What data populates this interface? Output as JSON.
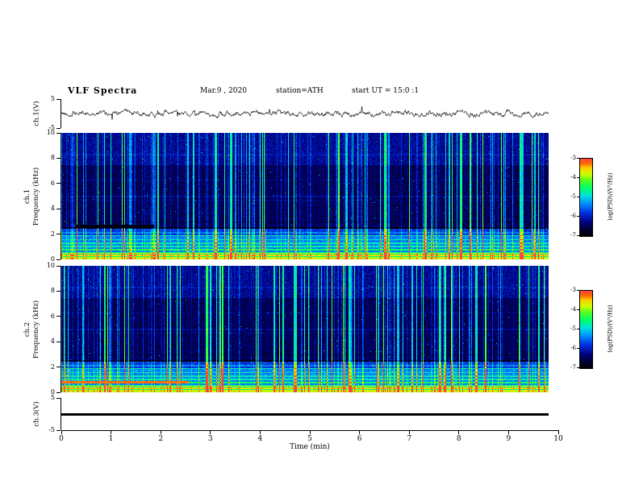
{
  "header": {
    "title": "VLF Spectra",
    "date": "Mar.9 , 2020",
    "station": "station=ATH",
    "start_ut": "start UT = 15:0 :1"
  },
  "x_axis": {
    "label": "Time (min)",
    "min": 0,
    "max": 10,
    "ticks": [
      0,
      1,
      2,
      3,
      4,
      5,
      6,
      7,
      8,
      9,
      10
    ]
  },
  "panels": {
    "ch1v": {
      "ylabel": "ch.1(V)",
      "ticks": [
        5,
        -5
      ],
      "min": -5,
      "max": 5
    },
    "spec1": {
      "ylabel_line1": "ch.1",
      "ylabel_line2": "Frequency (kHz)",
      "ticks": [
        0,
        2,
        4,
        6,
        8,
        10
      ],
      "min": 0,
      "max": 10
    },
    "spec2": {
      "ylabel_line1": "ch.2",
      "ylabel_line2": "Frequency (kHz)",
      "ticks": [
        0,
        2,
        4,
        6,
        8,
        10
      ],
      "min": 0,
      "max": 10
    },
    "ch3v": {
      "ylabel": "ch.3(V)",
      "ticks": [
        5,
        -5
      ],
      "min": -5,
      "max": 5
    }
  },
  "colorbars": [
    {
      "label": "log(PSD)/(V²/Hz)",
      "ticks": [
        -3,
        -4,
        -5,
        -6,
        -7
      ],
      "min": -7,
      "max": -3
    },
    {
      "label": "log(PSD)/(V²/Hz)",
      "ticks": [
        -3,
        -4,
        -5,
        -6,
        -7
      ],
      "min": -7,
      "max": -3
    }
  ],
  "colormap": [
    {
      "v": 0.0,
      "c": "#000000"
    },
    {
      "v": 0.08,
      "c": "#000030"
    },
    {
      "v": 0.18,
      "c": "#000080"
    },
    {
      "v": 0.3,
      "c": "#0030e0"
    },
    {
      "v": 0.42,
      "c": "#0090ff"
    },
    {
      "v": 0.52,
      "c": "#00e0e0"
    },
    {
      "v": 0.62,
      "c": "#00ff66"
    },
    {
      "v": 0.72,
      "c": "#55ff22"
    },
    {
      "v": 0.8,
      "c": "#ccff00"
    },
    {
      "v": 0.88,
      "c": "#ffcc00"
    },
    {
      "v": 0.94,
      "c": "#ff6600"
    },
    {
      "v": 1.0,
      "c": "#ff4444"
    }
  ],
  "chart_data": [
    {
      "type": "line",
      "name": "ch.1(V) time series",
      "xlabel": "Time (min)",
      "xlim": [
        0,
        10
      ],
      "x_data_extent": [
        0,
        9.8
      ],
      "ylabel": "ch.1(V)",
      "ylim": [
        -5,
        5
      ],
      "yticks": [
        5,
        -5
      ],
      "description": "Broadband noisy voltage waveform fluctuating about 0 V, typical amplitude roughly ±1 V with occasional larger spikes up to about ±2.5 V."
    },
    {
      "type": "heatmap",
      "name": "ch.1 VLF spectrogram",
      "xlabel": "Time (min)",
      "xlim": [
        0,
        10
      ],
      "x_data_extent": [
        0,
        9.8
      ],
      "ylabel": "Frequency (kHz)",
      "ylim": [
        0,
        10
      ],
      "zlabel": "log(PSD)/(V²/Hz)",
      "zlim": [
        -7,
        -3
      ],
      "description": "Strong power (green-yellow, about -4) below ~2 kHz with many discrete horizontal spectral lines; weak background (dark blue/black, -7 to -6) from ~2.5 to 7.5 kHz; slightly stronger blue band above ~8 kHz; dense vertical broadband impulses (sferics) spanning all frequencies throughout the record; a short dark notch near 2.6 kHz during the first ~2 min."
    },
    {
      "type": "heatmap",
      "name": "ch.2 VLF spectrogram",
      "xlabel": "Time (min)",
      "xlim": [
        0,
        10
      ],
      "x_data_extent": [
        0,
        9.8
      ],
      "ylabel": "Frequency (kHz)",
      "ylim": [
        0,
        10
      ],
      "zlabel": "log(PSD)/(V²/Hz)",
      "zlim": [
        -7,
        -3
      ],
      "description": "Same overall structure as ch.1: intense low-frequency band below ~2 kHz with horizontal lines, dark mid-band, dense vertical sferic streaks; additionally an intense orange-red narrowband emission near 0.8-1 kHz from 0 to about 2.5 min."
    },
    {
      "type": "line",
      "name": "ch.3(V) time series",
      "xlabel": "Time (min)",
      "xlim": [
        0,
        10
      ],
      "x_data_extent": [
        0,
        9.8
      ],
      "ylabel": "ch.3(V)",
      "ylim": [
        -5,
        5
      ],
      "yticks": [
        5,
        -5
      ],
      "description": "Constant 0 V (flat thick black line) for the whole record."
    }
  ]
}
